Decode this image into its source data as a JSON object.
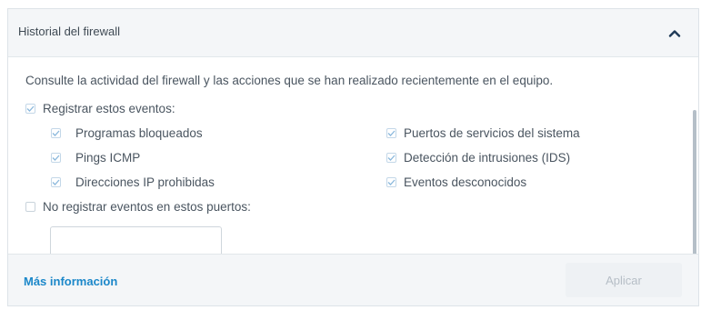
{
  "panel": {
    "title": "Historial del firewall",
    "collapse_icon": "chevron-up-icon"
  },
  "content": {
    "description": "Consulte la actividad del firewall y las acciones que se han realizado recientemente en el equipo.",
    "log_events": {
      "label": "Registrar estos eventos:",
      "checked": true
    },
    "events_left": [
      {
        "label": "Programas bloqueados",
        "checked": true
      },
      {
        "label": "Pings ICMP",
        "checked": true
      },
      {
        "label": "Direcciones IP prohibidas",
        "checked": true
      }
    ],
    "events_right": [
      {
        "label": "Puertos de servicios del sistema",
        "checked": true
      },
      {
        "label": "Detección de intrusiones (IDS)",
        "checked": true
      },
      {
        "label": "Eventos desconocidos",
        "checked": true
      }
    ],
    "exclude_ports": {
      "label": "No registrar eventos en estos puertos:",
      "checked": false
    },
    "ports_value": ""
  },
  "footer": {
    "more_info": "Más información",
    "apply": "Aplicar"
  },
  "colors": {
    "accent": "#1b87c9",
    "checkmark": "#8ab8dc",
    "header_bg": "#f4f6f8"
  }
}
